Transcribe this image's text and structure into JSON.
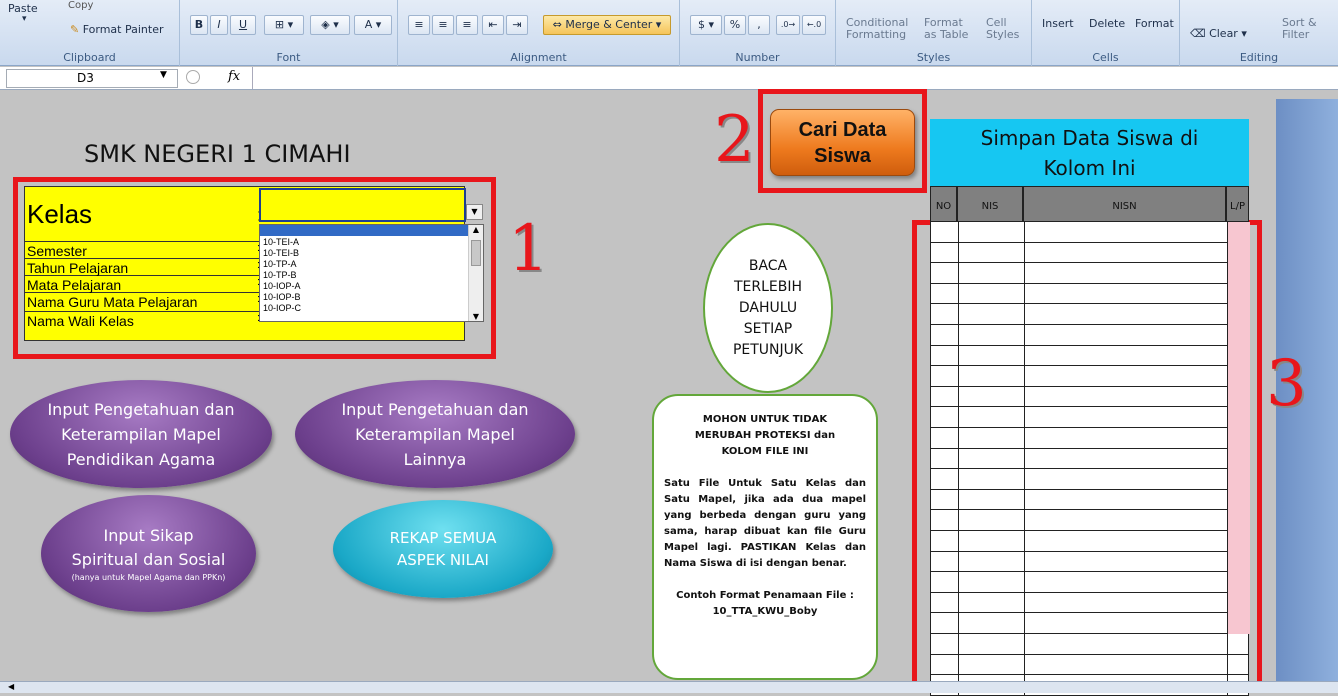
{
  "ribbon": {
    "clipboard": {
      "paste": "Paste",
      "copy": "Copy",
      "format_painter": "Format Painter",
      "label": "Clipboard"
    },
    "font": {
      "bold": "B",
      "italic": "I",
      "underline": "U",
      "label": "Font"
    },
    "alignment": {
      "merge_center": "Merge & Center",
      "label": "Alignment"
    },
    "number": {
      "percent": "%",
      "comma": ",",
      "label": "Number"
    },
    "styles": {
      "conditional": "Conditional\nFormatting",
      "format_table": "Format\nas Table",
      "cell_styles": "Cell\nStyles",
      "label": "Styles"
    },
    "cells": {
      "insert": "Insert",
      "delete": "Delete",
      "format": "Format",
      "label": "Cells"
    },
    "editing": {
      "clear": "Clear",
      "sort": "Sort &\nFilter",
      "label": "Editing"
    }
  },
  "formula_bar": {
    "name_box": "D3",
    "fx": "fx",
    "value": ""
  },
  "sheet": {
    "school_title": "SMK NEGERI 1 CIMAHI",
    "form": {
      "kelas": "Kelas",
      "semester": "Semester",
      "tahun": "Tahun Pelajaran",
      "mapel": "Mata Pelajaran",
      "guru": "Nama Guru Mata Pelajaran",
      "wali": "Nama Wali Kelas",
      "colon": ":"
    },
    "dropdown_options": [
      "10-TEI-A",
      "10-TEI-B",
      "10-TP-A",
      "10-TP-B",
      "10-IOP-A",
      "10-IOP-B",
      "10-IOP-C"
    ],
    "markers": {
      "one": "1",
      "two": "2",
      "three": "3"
    },
    "buttons": {
      "agama": "Input Pengetahuan dan Keterampilan Mapel Pendidikan Agama",
      "lainnya": "Input Pengetahuan dan Keterampilan Mapel Lainnya",
      "sikap": "Input Sikap Spiritual dan Sosial",
      "sikap_note": "(hanya untuk Mapel Agama dan PPKn)",
      "rekap": "REKAP SEMUA ASPEK NILAI",
      "cari": "Cari Data Siswa"
    },
    "baca": "BACA TERLEBIH DAHULU SETIAP PETUNJUK",
    "notes": {
      "warning": "MOHON UNTUK TIDAK MERUBAH PROTEKSI dan KOLOM FILE INI",
      "body": "Satu File Untuk Satu Kelas dan Satu Mapel, jika ada dua mapel yang berbeda dengan guru yang sama, harap dibuat kan file Guru Mapel lagi. PASTIKAN Kelas dan Nama Siswa di isi dengan benar.",
      "example_label": "Contoh Format Penamaan File :",
      "example_value": "10_TTA_KWU_Boby"
    },
    "simpan_title": "Simpan Data Siswa di Kolom Ini",
    "table_headers": {
      "no": "NO",
      "nis": "NIS",
      "nisn": "NISN",
      "lp": "L/P"
    },
    "pink_row_count": 20,
    "white_row_count": 3
  },
  "colors": {
    "outline": "#e8161b",
    "form_yellow": "#ffff00",
    "header_cyan": "#16c7f2",
    "lp_pink": "#f7c6d0"
  }
}
